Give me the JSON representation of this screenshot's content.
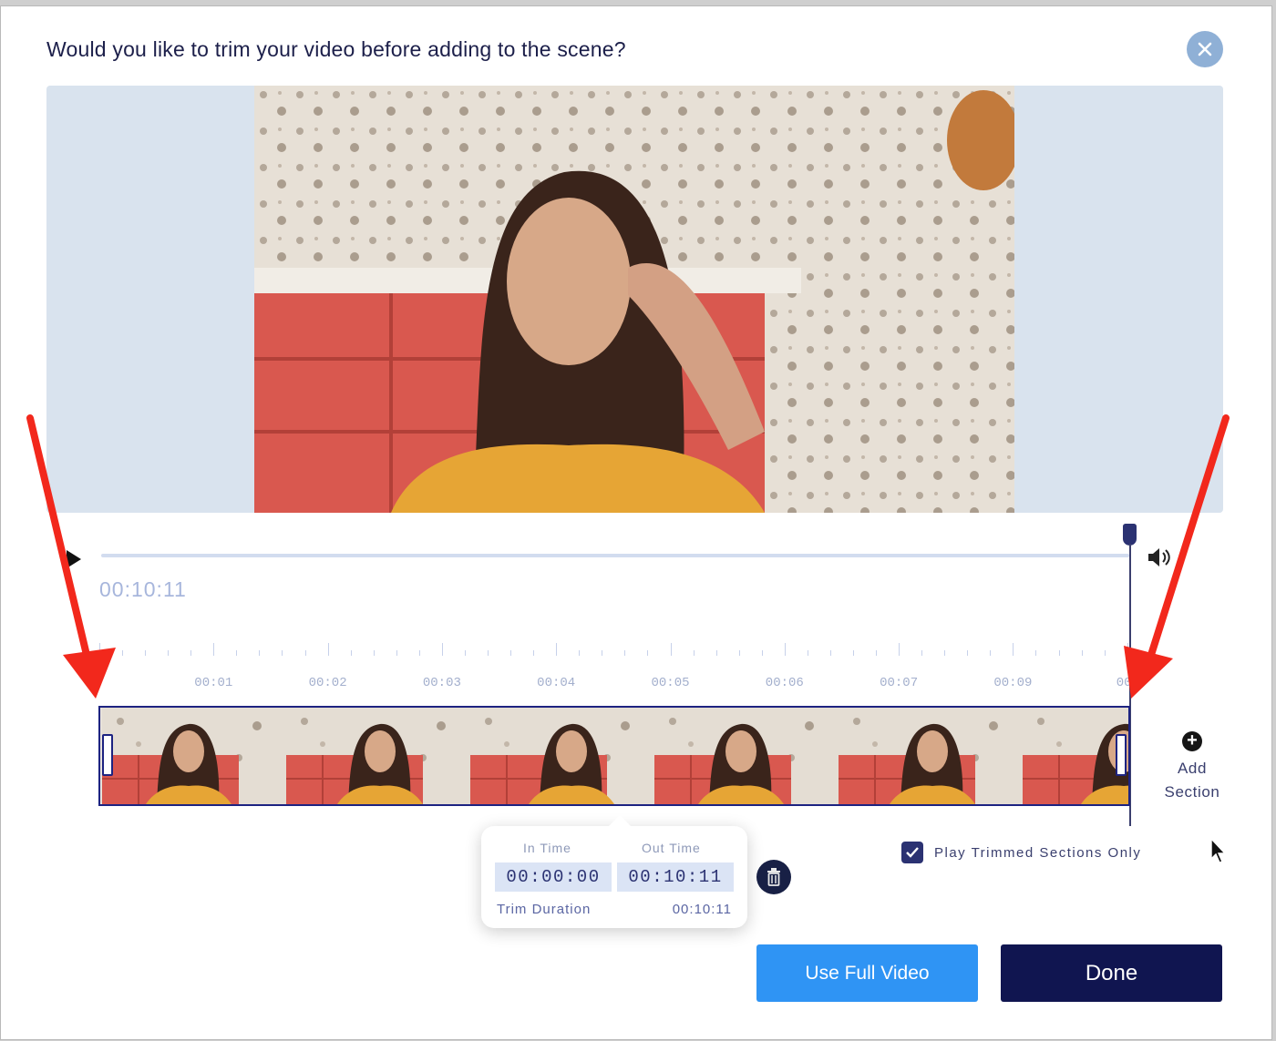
{
  "dialog": {
    "title": "Would you like to trim your video before adding to the scene?"
  },
  "player": {
    "current_time": "00:10:11"
  },
  "ruler": {
    "labels": [
      "00:01",
      "00:02",
      "00:03",
      "00:04",
      "00:05",
      "00:06",
      "00:07",
      "00:09",
      "00"
    ]
  },
  "trim": {
    "in_label": "In Time",
    "out_label": "Out Time",
    "in_value": "00:00:00",
    "out_value": "00:10:11",
    "duration_label": "Trim Duration",
    "duration_value": "00:10:11"
  },
  "add_section": {
    "line1": "Add",
    "line2": "Section"
  },
  "options": {
    "play_trimmed_label": "Play Trimmed Sections Only",
    "play_trimmed_checked": true
  },
  "buttons": {
    "use_full": "Use Full Video",
    "done": "Done"
  },
  "icons": {
    "close": "close-icon",
    "play": "play-icon",
    "volume": "volume-icon",
    "add": "plus-circle-icon",
    "trash": "trash-icon",
    "check": "check-icon",
    "cursor": "mouse-pointer-icon"
  },
  "colors": {
    "primary_dark": "#101550",
    "accent_blue": "#2f94f4",
    "annotation_red": "#f2281c"
  }
}
